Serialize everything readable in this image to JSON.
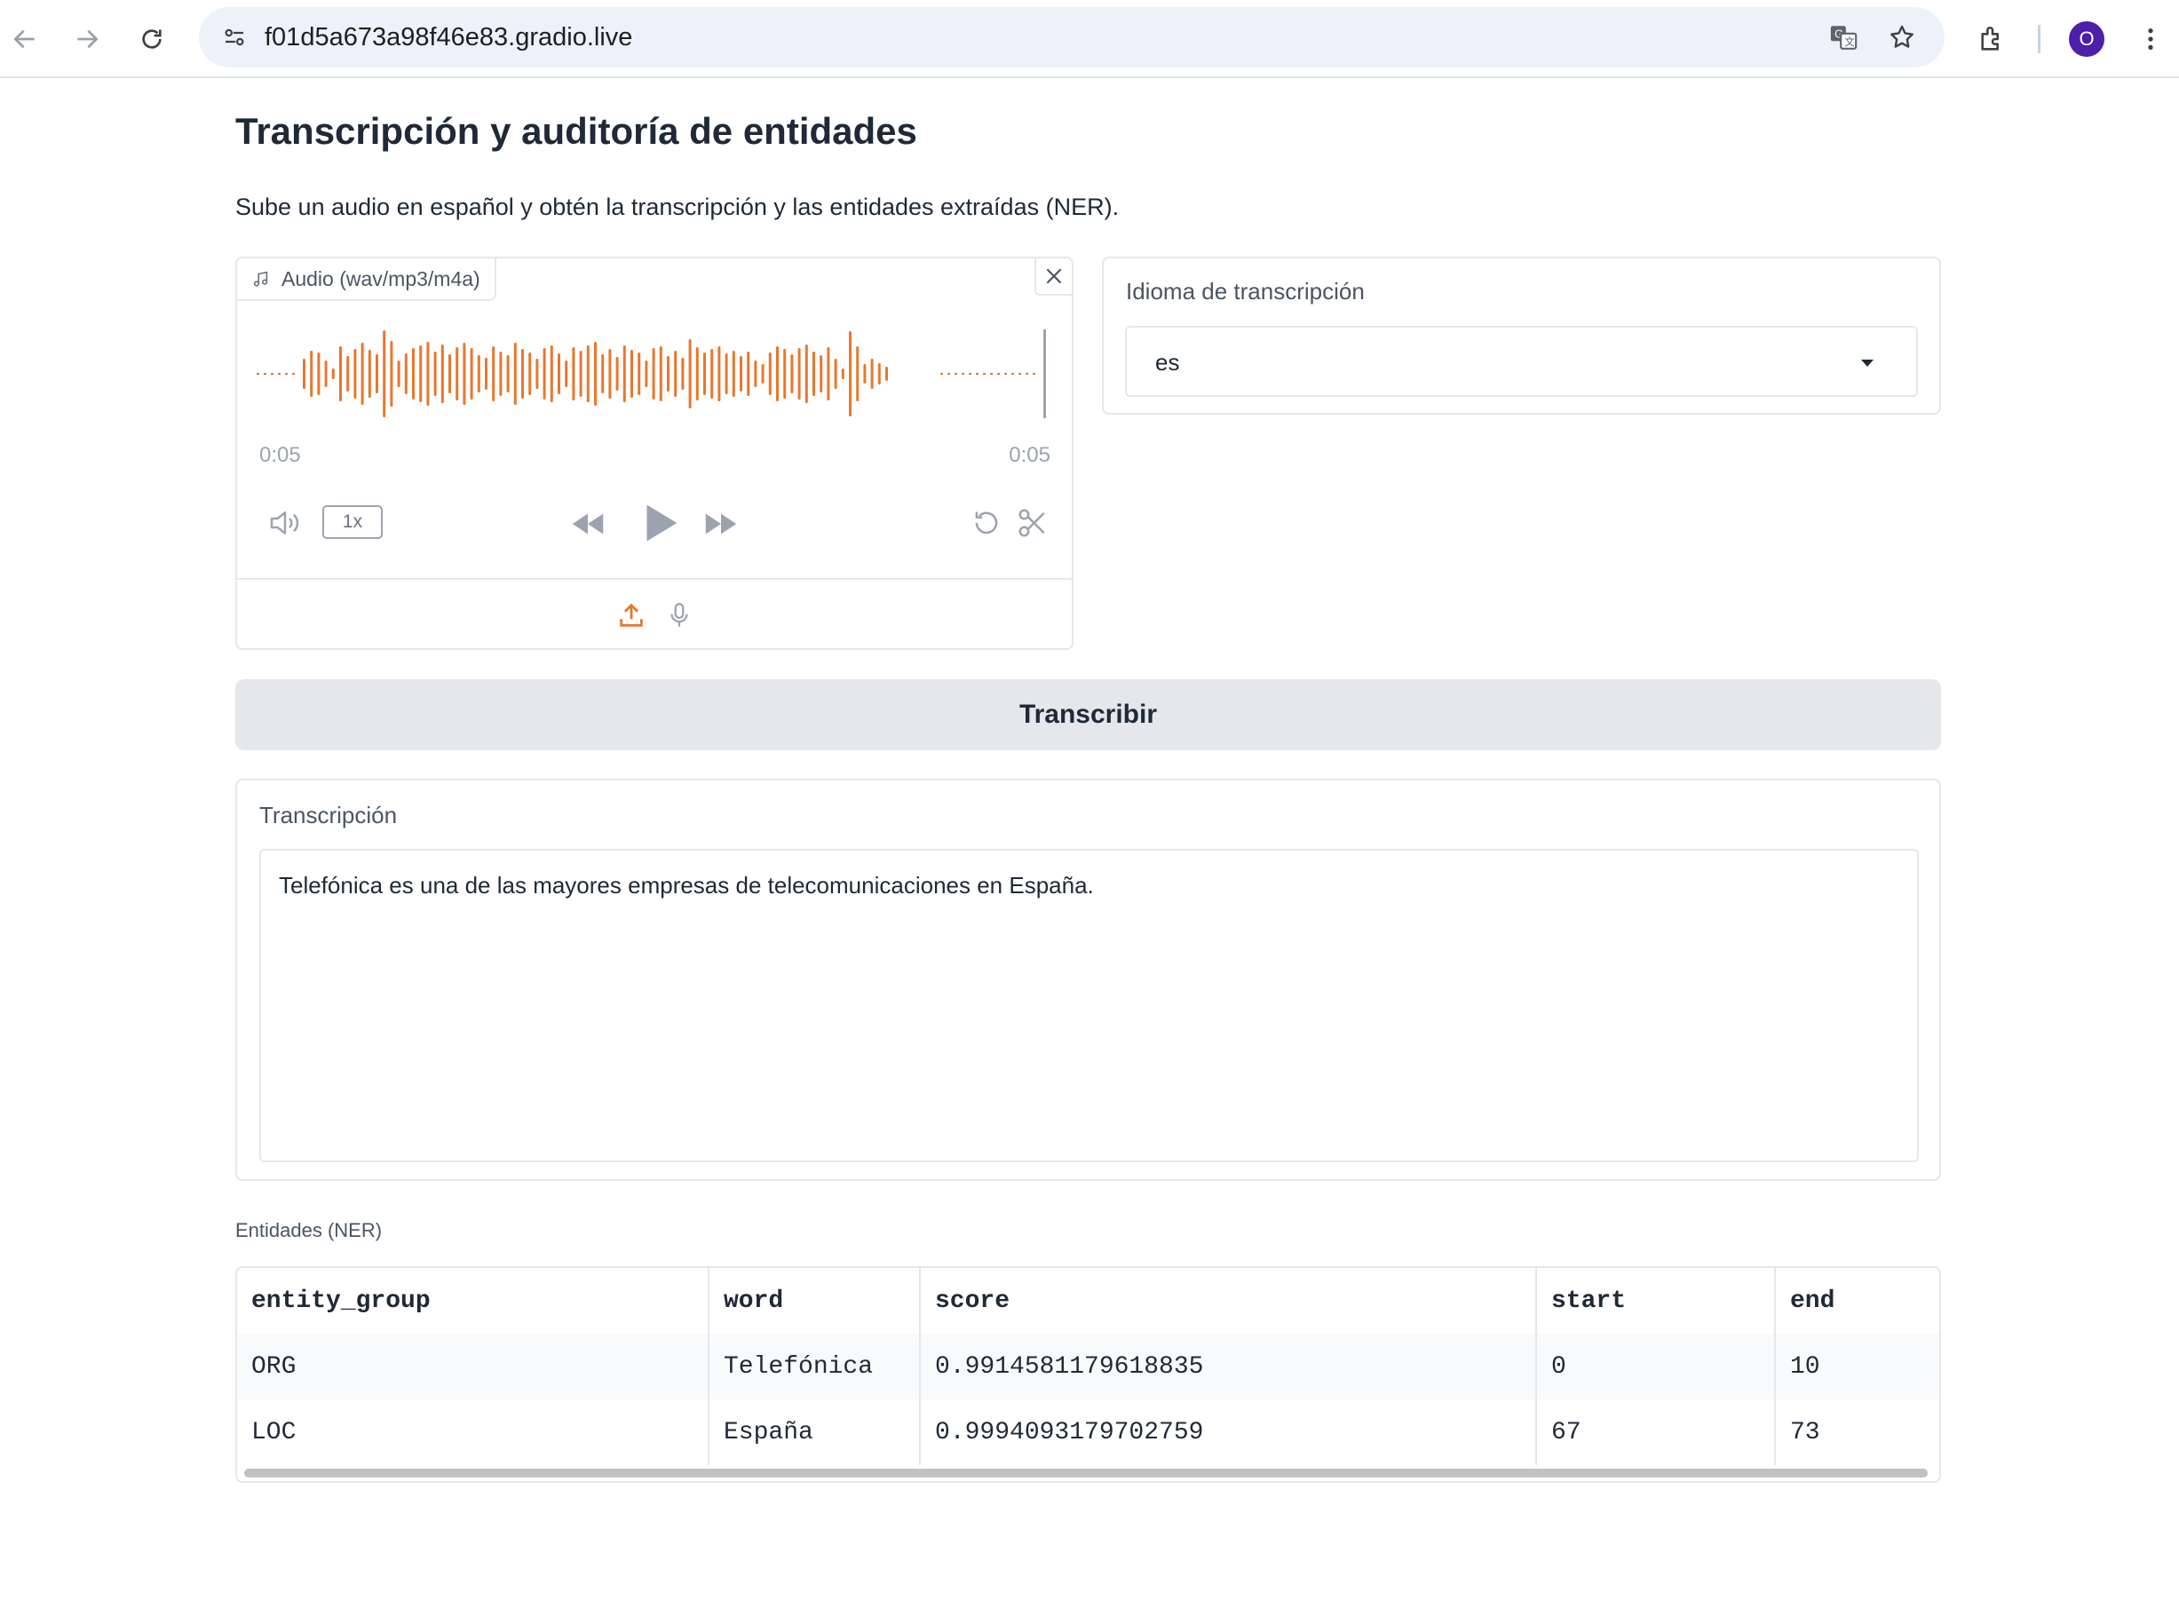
{
  "browser": {
    "url": "f01d5a673a98f46e83.gradio.live",
    "avatar_initial": "O",
    "accent_color": "#4b1fa8"
  },
  "page": {
    "title": "Transcripción y auditoría de entidades",
    "description": "Sube un audio en español y obtén la transcripción y las entidades extraídas (NER)."
  },
  "audio": {
    "label": "Audio (wav/mp3/m4a)",
    "time_current": "0:05",
    "time_total": "0:05",
    "playback_rate": "1x",
    "waveform_color": "#e8772e"
  },
  "language": {
    "label": "Idioma de transcripción",
    "selected": "es"
  },
  "actions": {
    "transcribe_label": "Transcribir"
  },
  "transcription": {
    "label": "Transcripción",
    "text": "Telefónica es una de las mayores empresas de telecomunicaciones en España."
  },
  "entities": {
    "label": "Entidades (NER)",
    "columns": [
      "entity_group",
      "word",
      "score",
      "start",
      "end"
    ],
    "rows": [
      [
        "ORG",
        "Telefónica",
        "0.9914581179618835",
        "0",
        "10"
      ],
      [
        "LOC",
        "España",
        "0.9994093179702759",
        "67",
        "73"
      ]
    ]
  }
}
